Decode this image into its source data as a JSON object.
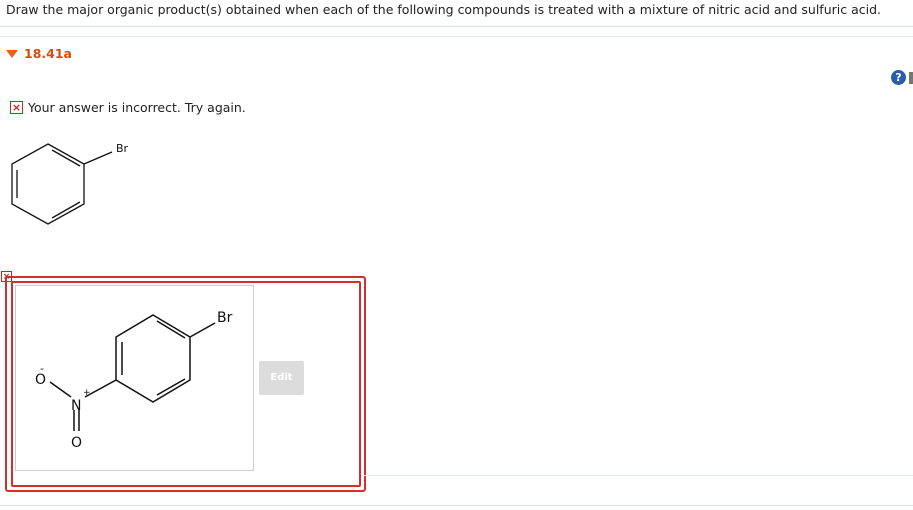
{
  "question": {
    "text": "Draw the major organic product(s) obtained when each of the following compounds is treated with a mixture of nitric acid and sulfuric acid."
  },
  "part": {
    "label": "18.41a",
    "icon": "triangle-down-icon",
    "accent_color": "#e8601c"
  },
  "help": {
    "icon": "help-icon",
    "glyph": "?"
  },
  "feedback": {
    "icon": "incorrect-x-icon",
    "glyph": "×",
    "text": "Your answer is incorrect.  Try again.",
    "color": "#c62828"
  },
  "reactant": {
    "substituent": "Br"
  },
  "product": {
    "substituent_top": "Br",
    "atom_o_minus": "O",
    "charge_minus": "-",
    "atom_n": "N",
    "charge_plus": "+",
    "atom_o_double": "O"
  },
  "answer_box": {
    "status_icon": "incorrect-x-icon",
    "glyph": "×",
    "border_color": "#d32f2f"
  },
  "edit_button": {
    "label": "Edit"
  }
}
